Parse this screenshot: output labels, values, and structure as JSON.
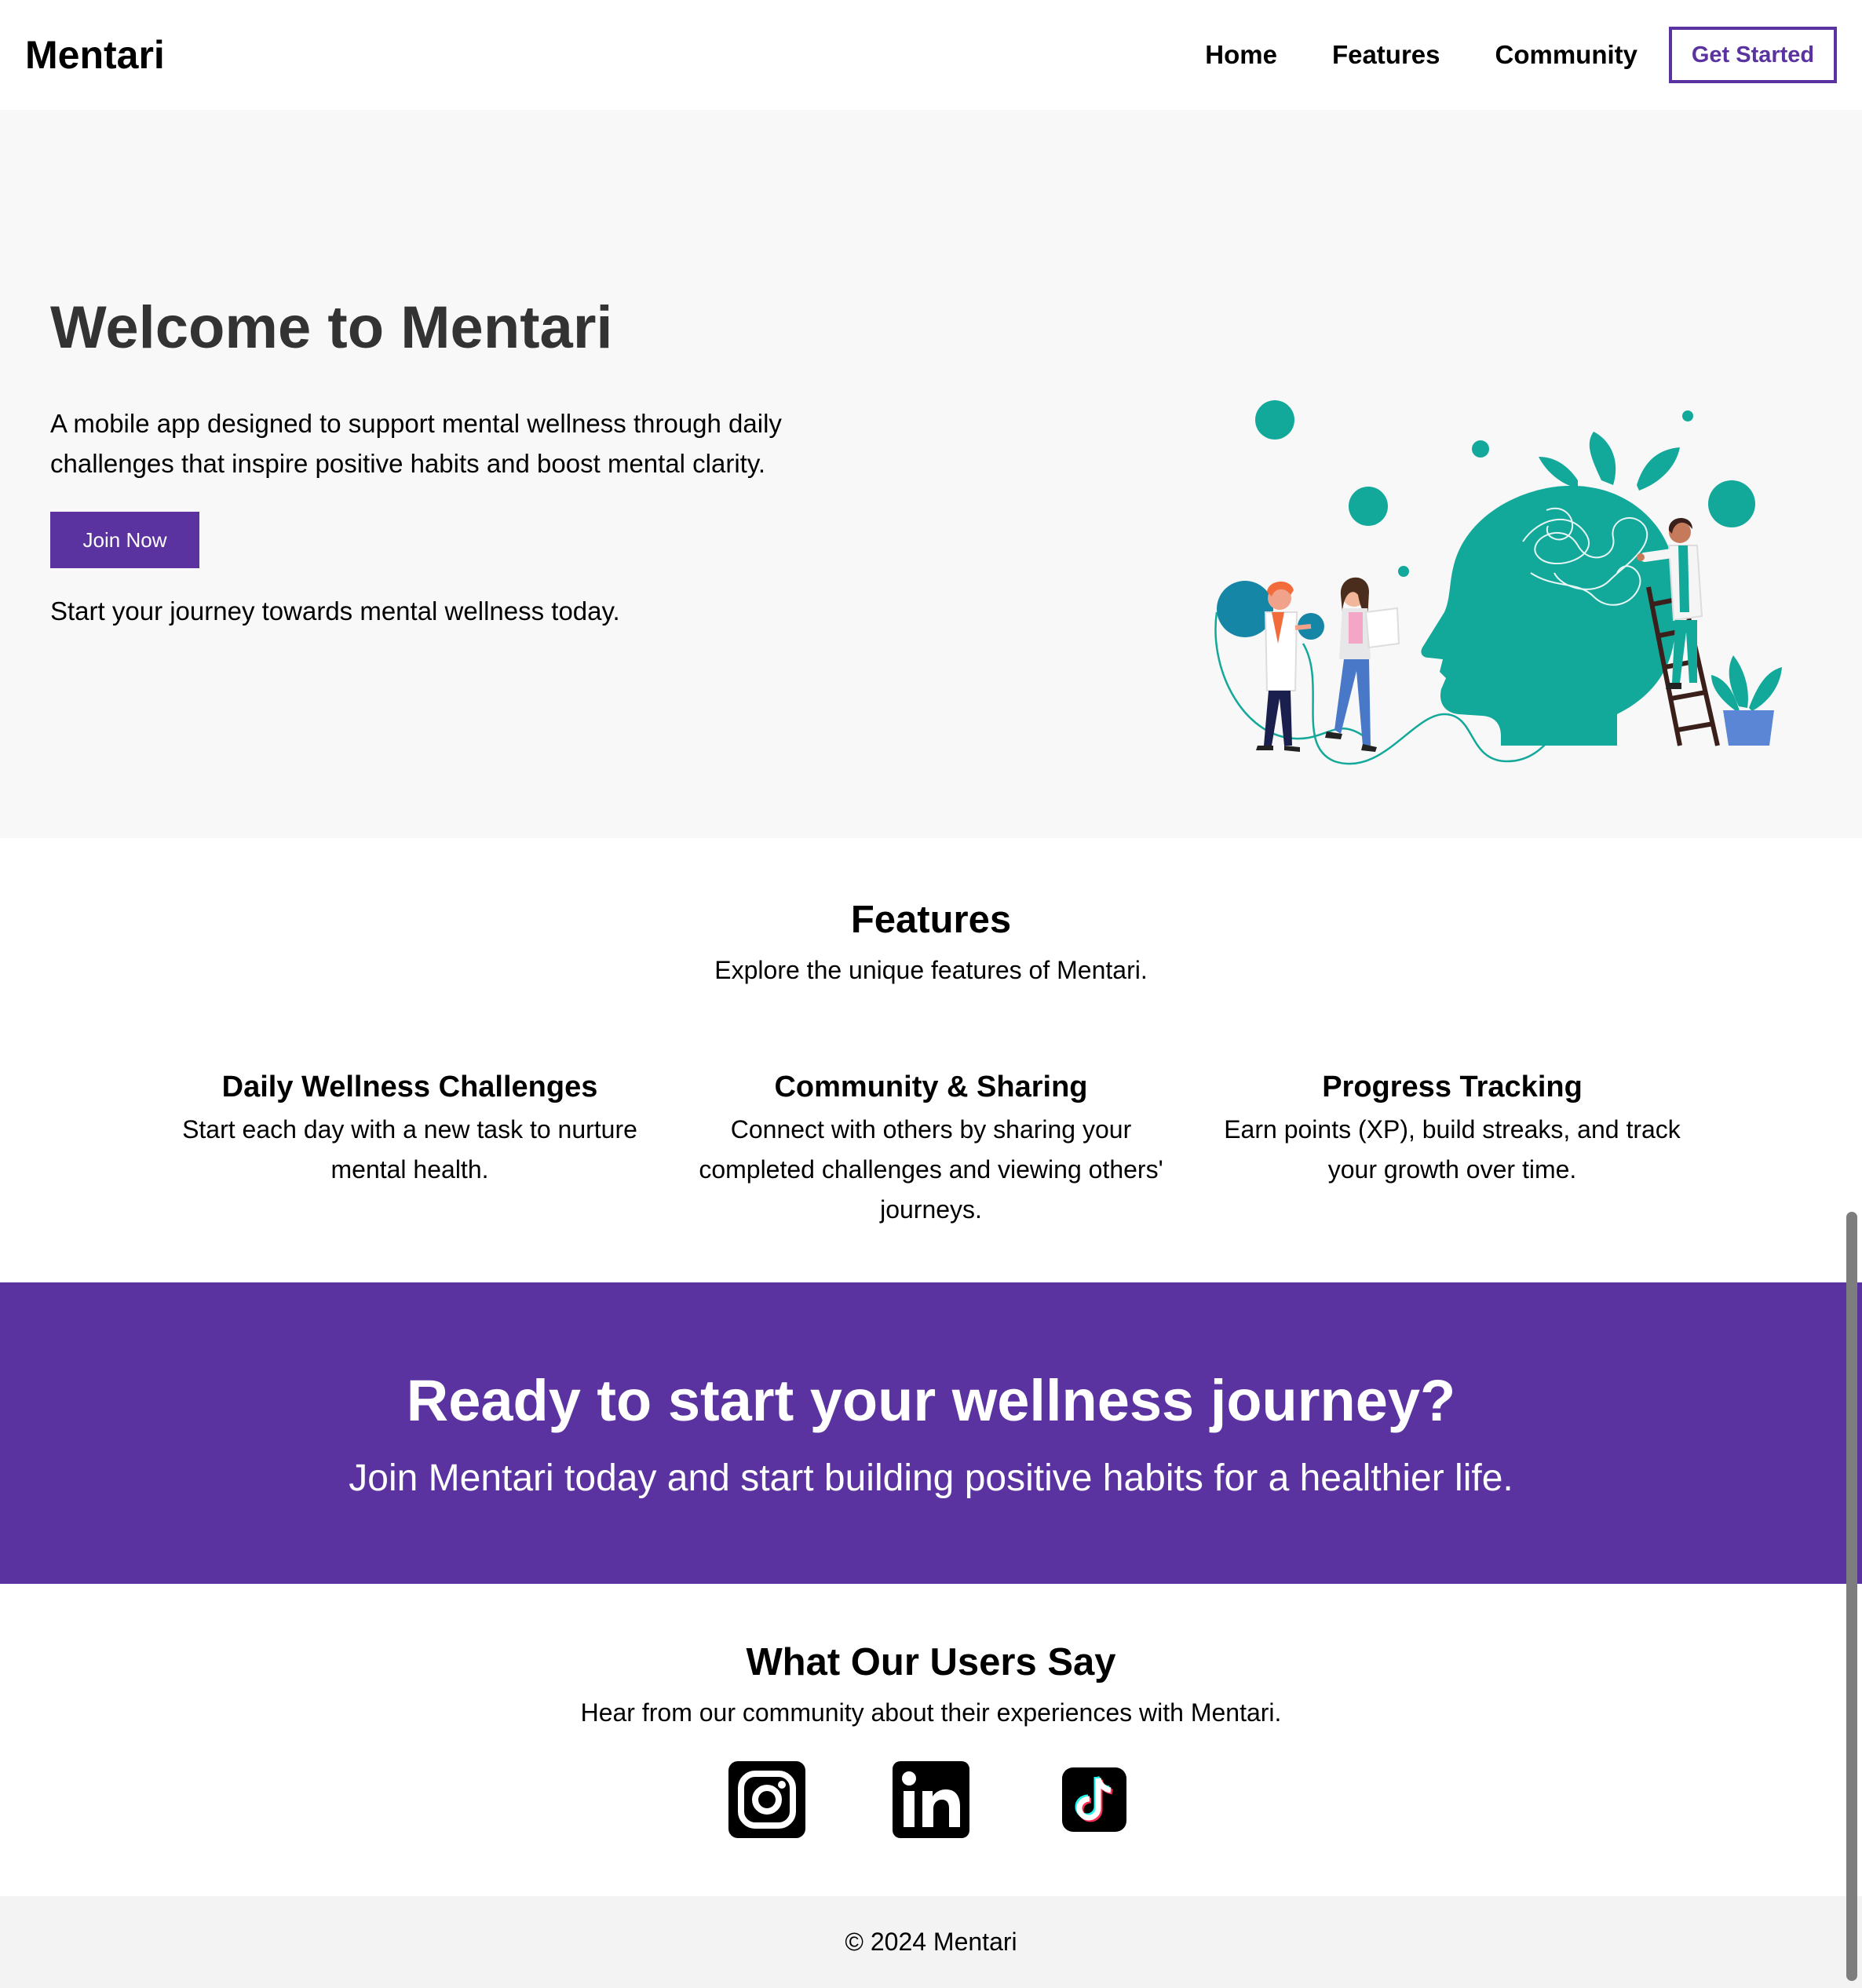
{
  "nav": {
    "logo": "Mentari",
    "links": [
      "Home",
      "Features",
      "Community"
    ],
    "cta_label": "Get Started"
  },
  "hero": {
    "title": "Welcome to Mentari",
    "description": "A mobile app designed to support mental wellness through daily challenges that inspire positive habits and boost mental clarity.",
    "button_label": "Join Now",
    "note": "Start your journey towards mental wellness today.",
    "illustration": "mental-health-head-illustration"
  },
  "features": {
    "title": "Features",
    "subtitle": "Explore the unique features of Mentari.",
    "items": [
      {
        "title": "Daily Wellness Challenges",
        "description": "Start each day with a new task to nurture mental health."
      },
      {
        "title": "Community & Sharing",
        "description": "Connect with others by sharing your completed challenges and viewing others' journeys."
      },
      {
        "title": "Progress Tracking",
        "description": "Earn points (XP), build streaks, and track your growth over time."
      }
    ]
  },
  "cta": {
    "title": "Ready to start your wellness journey?",
    "subtitle": "Join Mentari today and start building positive habits for a healthier life."
  },
  "testimonials": {
    "title": "What Our Users Say",
    "subtitle": "Hear from our community about their experiences with Mentari.",
    "social": [
      "instagram-icon",
      "linkedin-icon",
      "tiktok-icon"
    ]
  },
  "footer": {
    "copyright": "© 2024 Mentari"
  },
  "colors": {
    "brand_purple": "#5a33a0",
    "teal": "#12a99b",
    "hero_bg": "#f8f8f8",
    "footer_bg": "#f3f3f3"
  }
}
